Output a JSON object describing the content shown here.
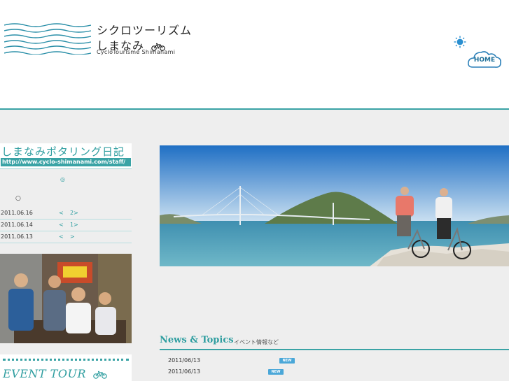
{
  "header": {
    "logo_title": "シクロツーリズム",
    "logo_subtitle": "しまなみ",
    "logo_english": "CycloTourisme Shimanami",
    "home_label": "HOME"
  },
  "sidebar": {
    "diary_title": "しまなみポタリング日記",
    "diary_url": "http://www.cyclo-shimanami.com/staff/",
    "circle_mark": "○",
    "entries": [
      {
        "date": "2011.06.16",
        "prev": "<",
        "num": "2>"
      },
      {
        "date": "2011.06.14",
        "prev": "<",
        "num": "1>"
      },
      {
        "date": "2011.06.13",
        "prev": "<",
        "num": ">"
      }
    ],
    "event_title": "EVENT TOUR"
  },
  "news": {
    "title": "News & Topics",
    "subtitle": "イベント情報など",
    "items": [
      {
        "date": "2011/06/13",
        "badge": "NEW"
      },
      {
        "date": "2011/06/13",
        "badge": "NEW"
      }
    ]
  },
  "colors": {
    "teal": "#3aa3a5",
    "gray_bg": "#eeeeee",
    "badge_blue": "#4aa7d8"
  }
}
